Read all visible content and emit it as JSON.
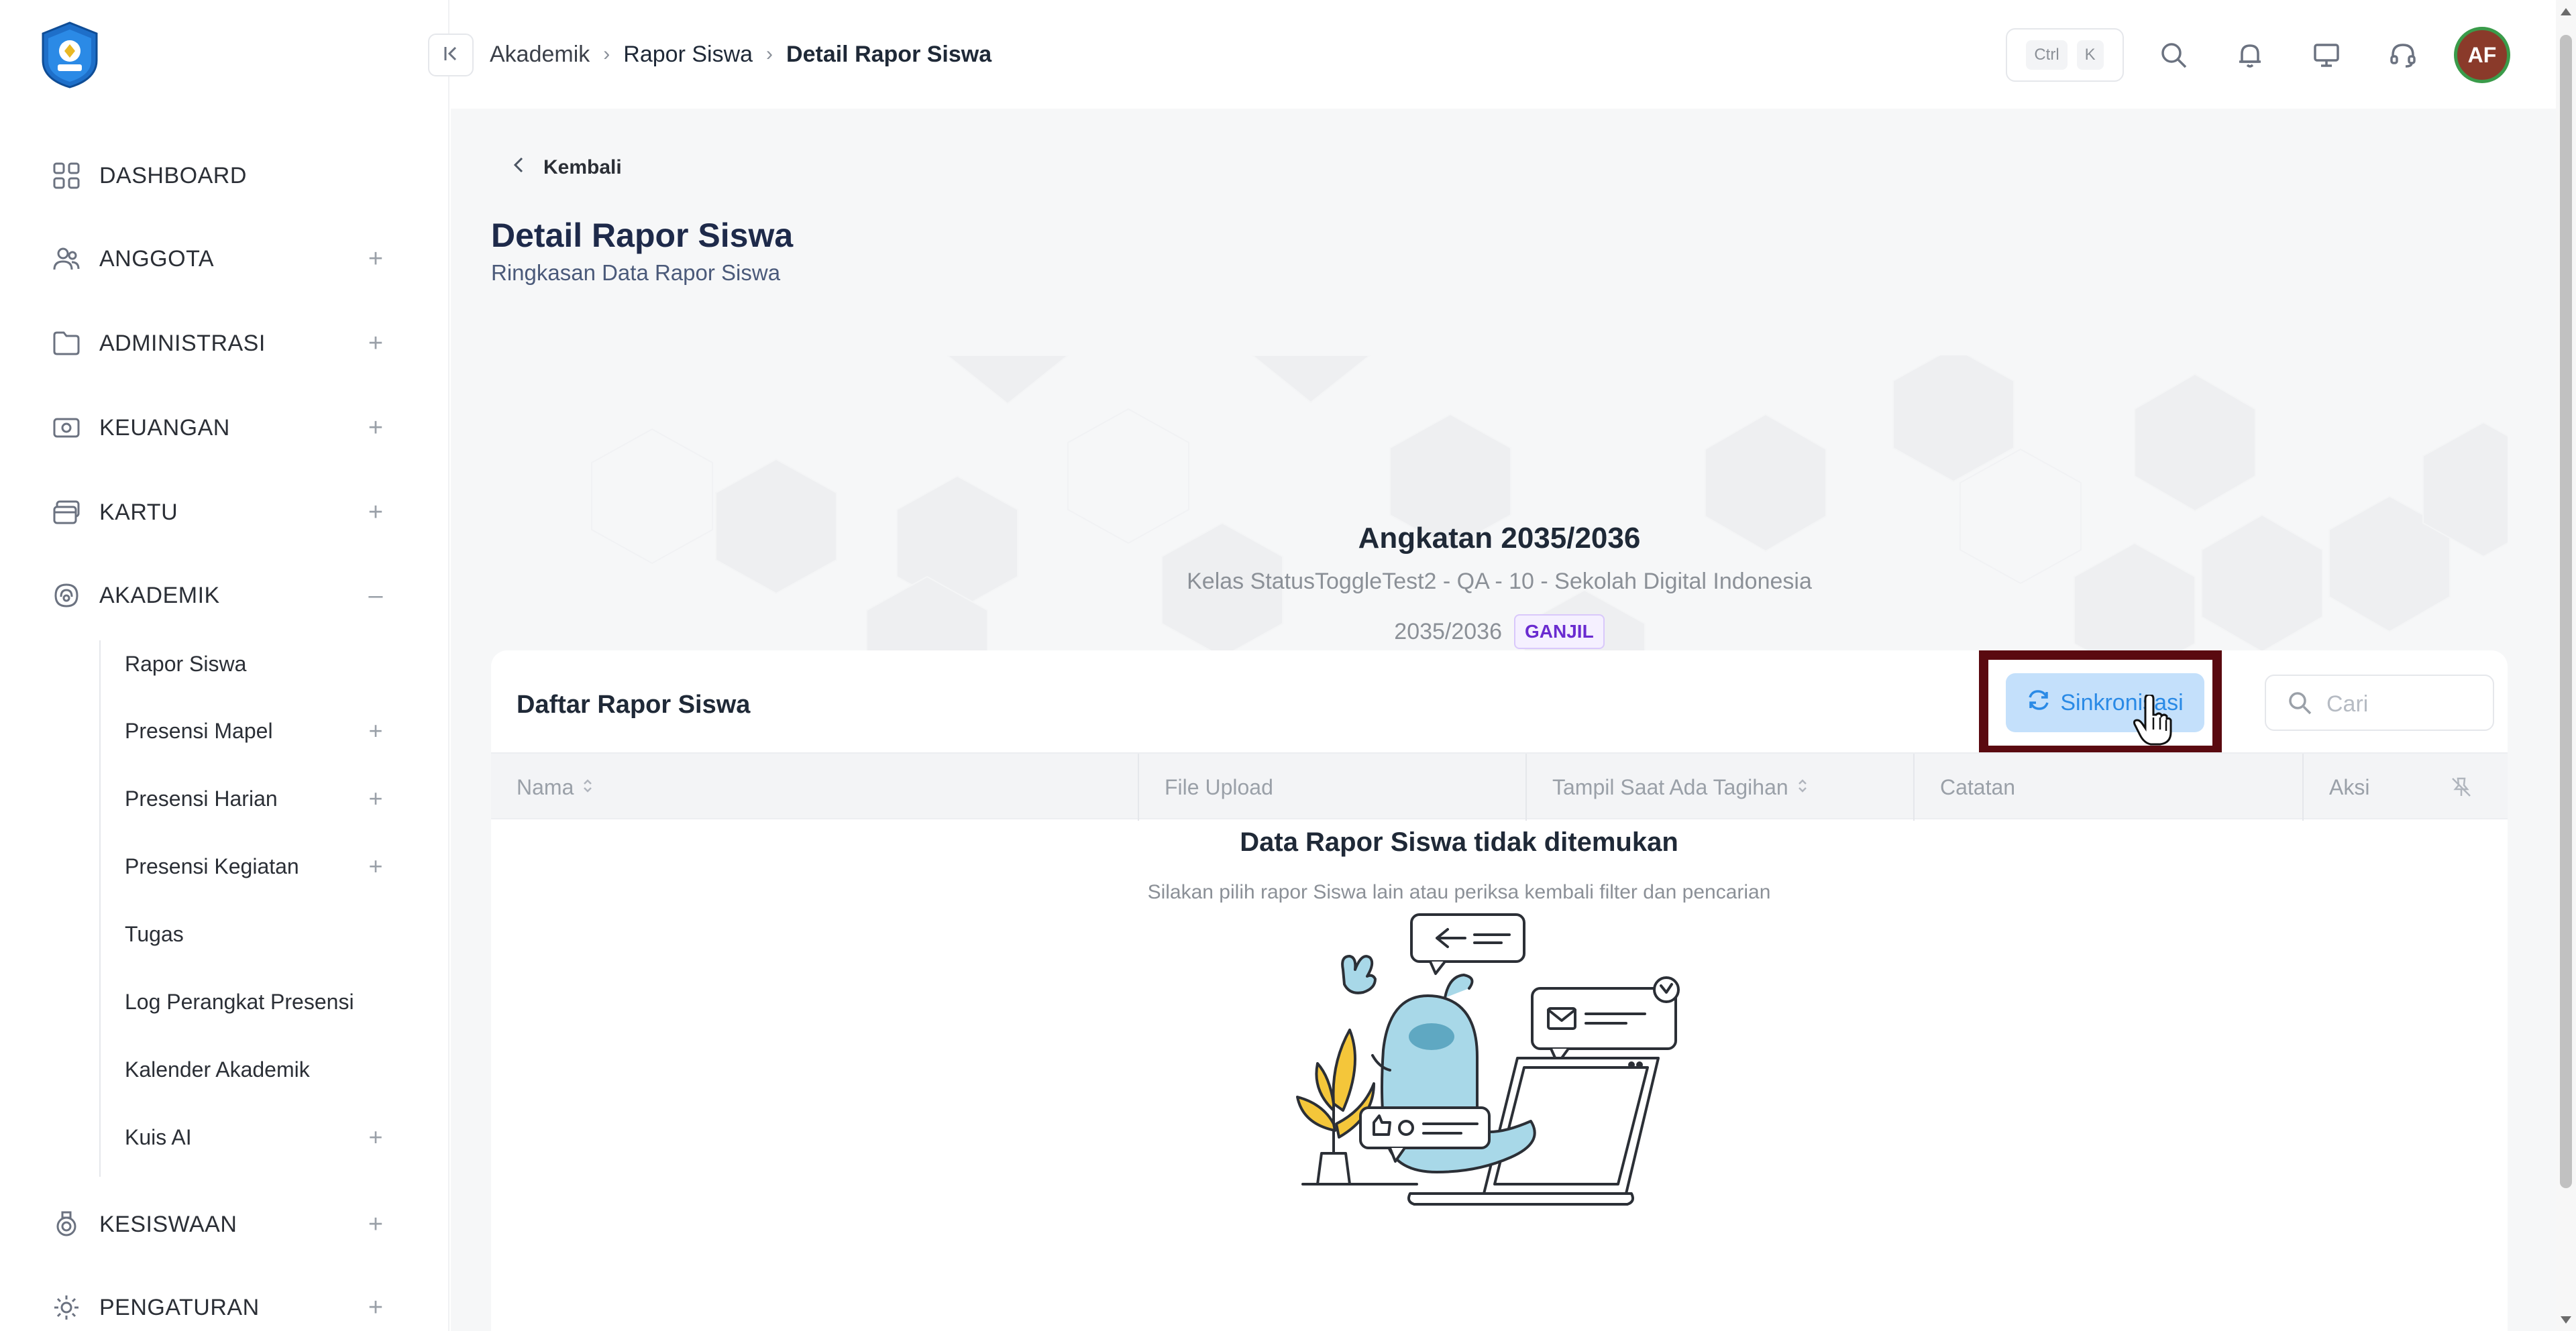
{
  "sidebar": {
    "items": [
      {
        "label": "DASHBOARD",
        "icon": "dashboard-grid-icon",
        "toggle": ""
      },
      {
        "label": "ANGGOTA",
        "icon": "users-icon",
        "toggle": "+"
      },
      {
        "label": "ADMINISTRASI",
        "icon": "folder-icon",
        "toggle": "+"
      },
      {
        "label": "KEUANGAN",
        "icon": "money-icon",
        "toggle": "+"
      },
      {
        "label": "KARTU",
        "icon": "card-icon",
        "toggle": "+"
      },
      {
        "label": "AKADEMIK",
        "icon": "academic-icon",
        "toggle": "–"
      },
      {
        "label": "KESISWAAN",
        "icon": "student-icon",
        "toggle": "+"
      },
      {
        "label": "PENGATURAN",
        "icon": "settings-icon",
        "toggle": "+"
      }
    ],
    "akademik_sub": [
      {
        "label": "Rapor Siswa",
        "toggle": ""
      },
      {
        "label": "Presensi Mapel",
        "toggle": "+"
      },
      {
        "label": "Presensi Harian",
        "toggle": "+"
      },
      {
        "label": "Presensi Kegiatan",
        "toggle": "+"
      },
      {
        "label": "Tugas",
        "toggle": ""
      },
      {
        "label": "Log Perangkat Presensi",
        "toggle": ""
      },
      {
        "label": "Kalender Akademik",
        "toggle": ""
      },
      {
        "label": "Kuis AI",
        "toggle": "+"
      }
    ]
  },
  "header": {
    "breadcrumb": [
      "Akademik",
      "Rapor Siswa",
      "Detail Rapor Siswa"
    ],
    "shortcut": {
      "key1": "Ctrl",
      "key2": "K"
    },
    "avatar_initials": "AF",
    "icons": [
      "search-icon",
      "bell-icon",
      "monitor-icon",
      "headset-icon"
    ]
  },
  "page": {
    "back_label": "Kembali",
    "title": "Detail Rapor Siswa",
    "subtitle": "Ringkasan Data Rapor Siswa"
  },
  "banner": {
    "title": "Angkatan 2035/2036",
    "subtitle": "Kelas StatusToggleTest2 - QA - 10 - Sekolah Digital Indonesia",
    "year": "2035/2036",
    "semester_badge": "GANJIL"
  },
  "card": {
    "title": "Daftar Rapor Siswa",
    "sync_label": "Sinkronisasi",
    "search_placeholder": "Cari",
    "columns": [
      {
        "label": "Nama",
        "sortable": true
      },
      {
        "label": "File Upload",
        "sortable": false
      },
      {
        "label": "Tampil Saat Ada Tagihan",
        "sortable": true
      },
      {
        "label": "Catatan",
        "sortable": false
      },
      {
        "label": "Aksi",
        "sortable": false
      }
    ],
    "empty_title": "Data Rapor Siswa tidak ditemukan",
    "empty_subtitle": "Silakan pilih rapor Siswa lain atau periksa kembali filter dan pencarian"
  },
  "colors": {
    "accent": "#2a8ae6",
    "highlight_border": "#5a0a10",
    "badge_text": "#6a2bd0",
    "avatar_bg": "#8a3a2a",
    "avatar_ring": "#3a9b4a"
  }
}
